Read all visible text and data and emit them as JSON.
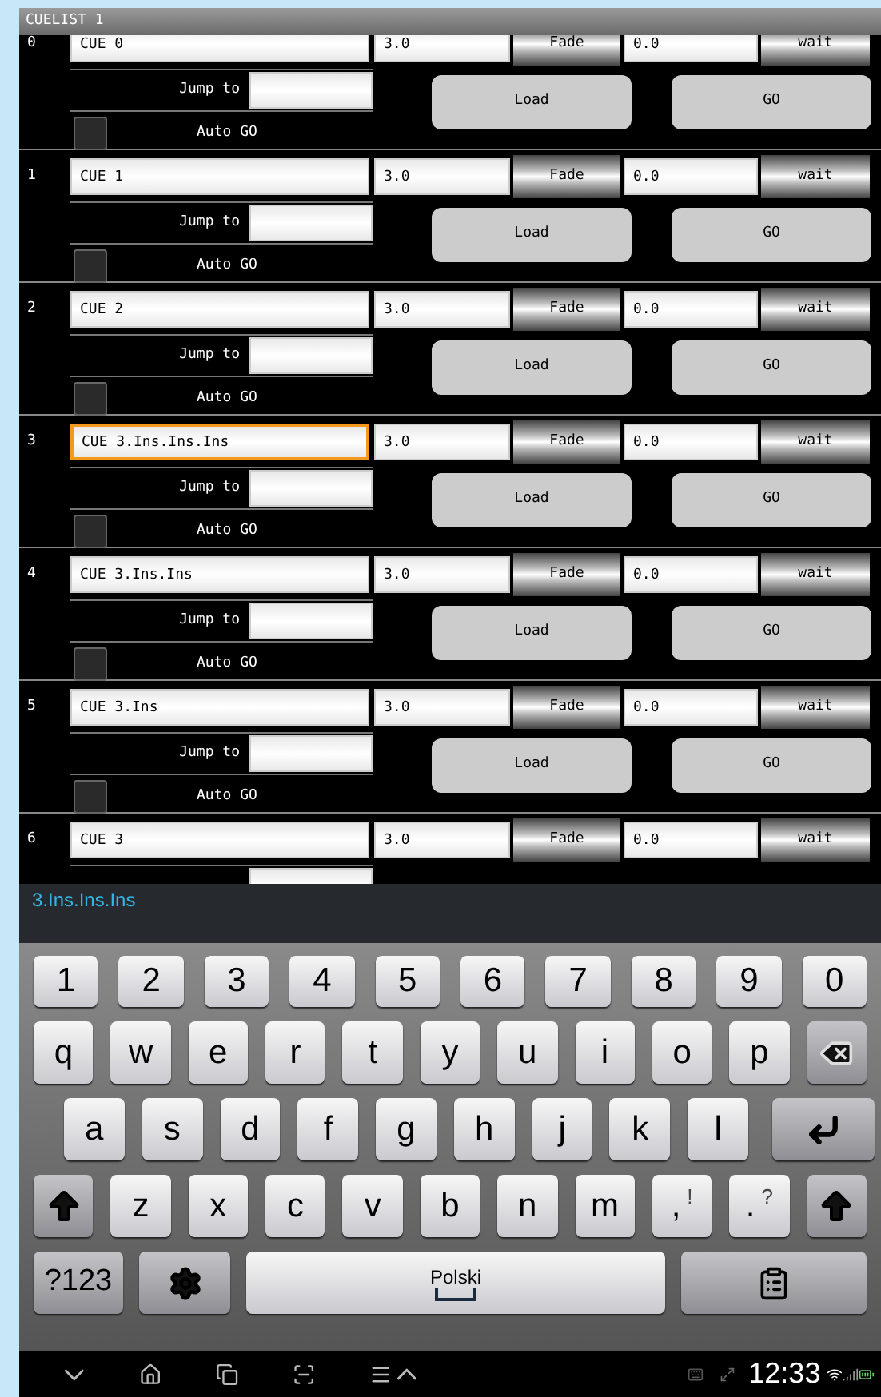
{
  "window": {
    "title": "CUELIST 1"
  },
  "cues": [
    {
      "index": "0",
      "name": "CUE 0",
      "duration": "3.0",
      "fade": "Fade",
      "delay": "0.0",
      "wait": "wait",
      "jump_label": "Jump to",
      "auto_go_label": "Auto GO",
      "auto_go": false,
      "load": "Load",
      "go": "GO",
      "selected": false
    },
    {
      "index": "1",
      "name": "CUE 1",
      "duration": "3.0",
      "fade": "Fade",
      "delay": "0.0",
      "wait": "wait",
      "jump_label": "Jump to",
      "auto_go_label": "Auto GO",
      "auto_go": false,
      "load": "Load",
      "go": "GO",
      "selected": false
    },
    {
      "index": "2",
      "name": "CUE 2",
      "duration": "3.0",
      "fade": "Fade",
      "delay": "0.0",
      "wait": "wait",
      "jump_label": "Jump to",
      "auto_go_label": "Auto GO",
      "auto_go": false,
      "load": "Load",
      "go": "GO",
      "selected": false
    },
    {
      "index": "3",
      "name": "CUE 3.Ins.Ins.Ins",
      "duration": "3.0",
      "fade": "Fade",
      "delay": "0.0",
      "wait": "wait",
      "jump_label": "Jump to",
      "auto_go_label": "Auto GO",
      "auto_go": false,
      "load": "Load",
      "go": "GO",
      "selected": true
    },
    {
      "index": "4",
      "name": "CUE 3.Ins.Ins",
      "duration": "3.0",
      "fade": "Fade",
      "delay": "0.0",
      "wait": "wait",
      "jump_label": "Jump to",
      "auto_go_label": "Auto GO",
      "auto_go": false,
      "load": "Load",
      "go": "GO",
      "selected": false
    },
    {
      "index": "5",
      "name": "CUE 3.Ins",
      "duration": "3.0",
      "fade": "Fade",
      "delay": "0.0",
      "wait": "wait",
      "jump_label": "Jump to",
      "auto_go_label": "Auto GO",
      "auto_go": false,
      "load": "Load",
      "go": "GO",
      "selected": false
    },
    {
      "index": "6",
      "name": "CUE 3",
      "duration": "3.0",
      "fade": "Fade",
      "delay": "0.0",
      "wait": "wait",
      "selected": false
    }
  ],
  "suggestion": "3.Ins.Ins.Ins",
  "keyboard": {
    "rows": [
      [
        {
          "label": "1"
        },
        {
          "label": "2"
        },
        {
          "label": "3"
        },
        {
          "label": "4"
        },
        {
          "label": "5"
        },
        {
          "label": "6"
        },
        {
          "label": "7"
        },
        {
          "label": "8"
        },
        {
          "label": "9"
        },
        {
          "label": "0"
        }
      ],
      [
        {
          "label": "q"
        },
        {
          "label": "w"
        },
        {
          "label": "e"
        },
        {
          "label": "r"
        },
        {
          "label": "t"
        },
        {
          "label": "y"
        },
        {
          "label": "u"
        },
        {
          "label": "i"
        },
        {
          "label": "o"
        },
        {
          "label": "p"
        },
        {
          "kind": "backspace"
        }
      ],
      [
        {
          "label": "a"
        },
        {
          "label": "s"
        },
        {
          "label": "d"
        },
        {
          "label": "f"
        },
        {
          "label": "g"
        },
        {
          "label": "h"
        },
        {
          "label": "j"
        },
        {
          "label": "k"
        },
        {
          "label": "l"
        },
        {
          "kind": "enter"
        }
      ],
      [
        {
          "kind": "shift"
        },
        {
          "label": "z"
        },
        {
          "label": "x"
        },
        {
          "label": "c"
        },
        {
          "label": "v"
        },
        {
          "label": "b"
        },
        {
          "label": "n"
        },
        {
          "label": "m"
        },
        {
          "label": ",",
          "alt": "!"
        },
        {
          "label": ".",
          "alt": "?"
        },
        {
          "kind": "shift"
        }
      ],
      [
        {
          "kind": "mode",
          "label": "?123"
        },
        {
          "kind": "settings"
        },
        {
          "kind": "space",
          "label": "Polski"
        },
        {
          "kind": "clipboard"
        }
      ]
    ]
  },
  "status_bar": {
    "time": "12:33"
  }
}
